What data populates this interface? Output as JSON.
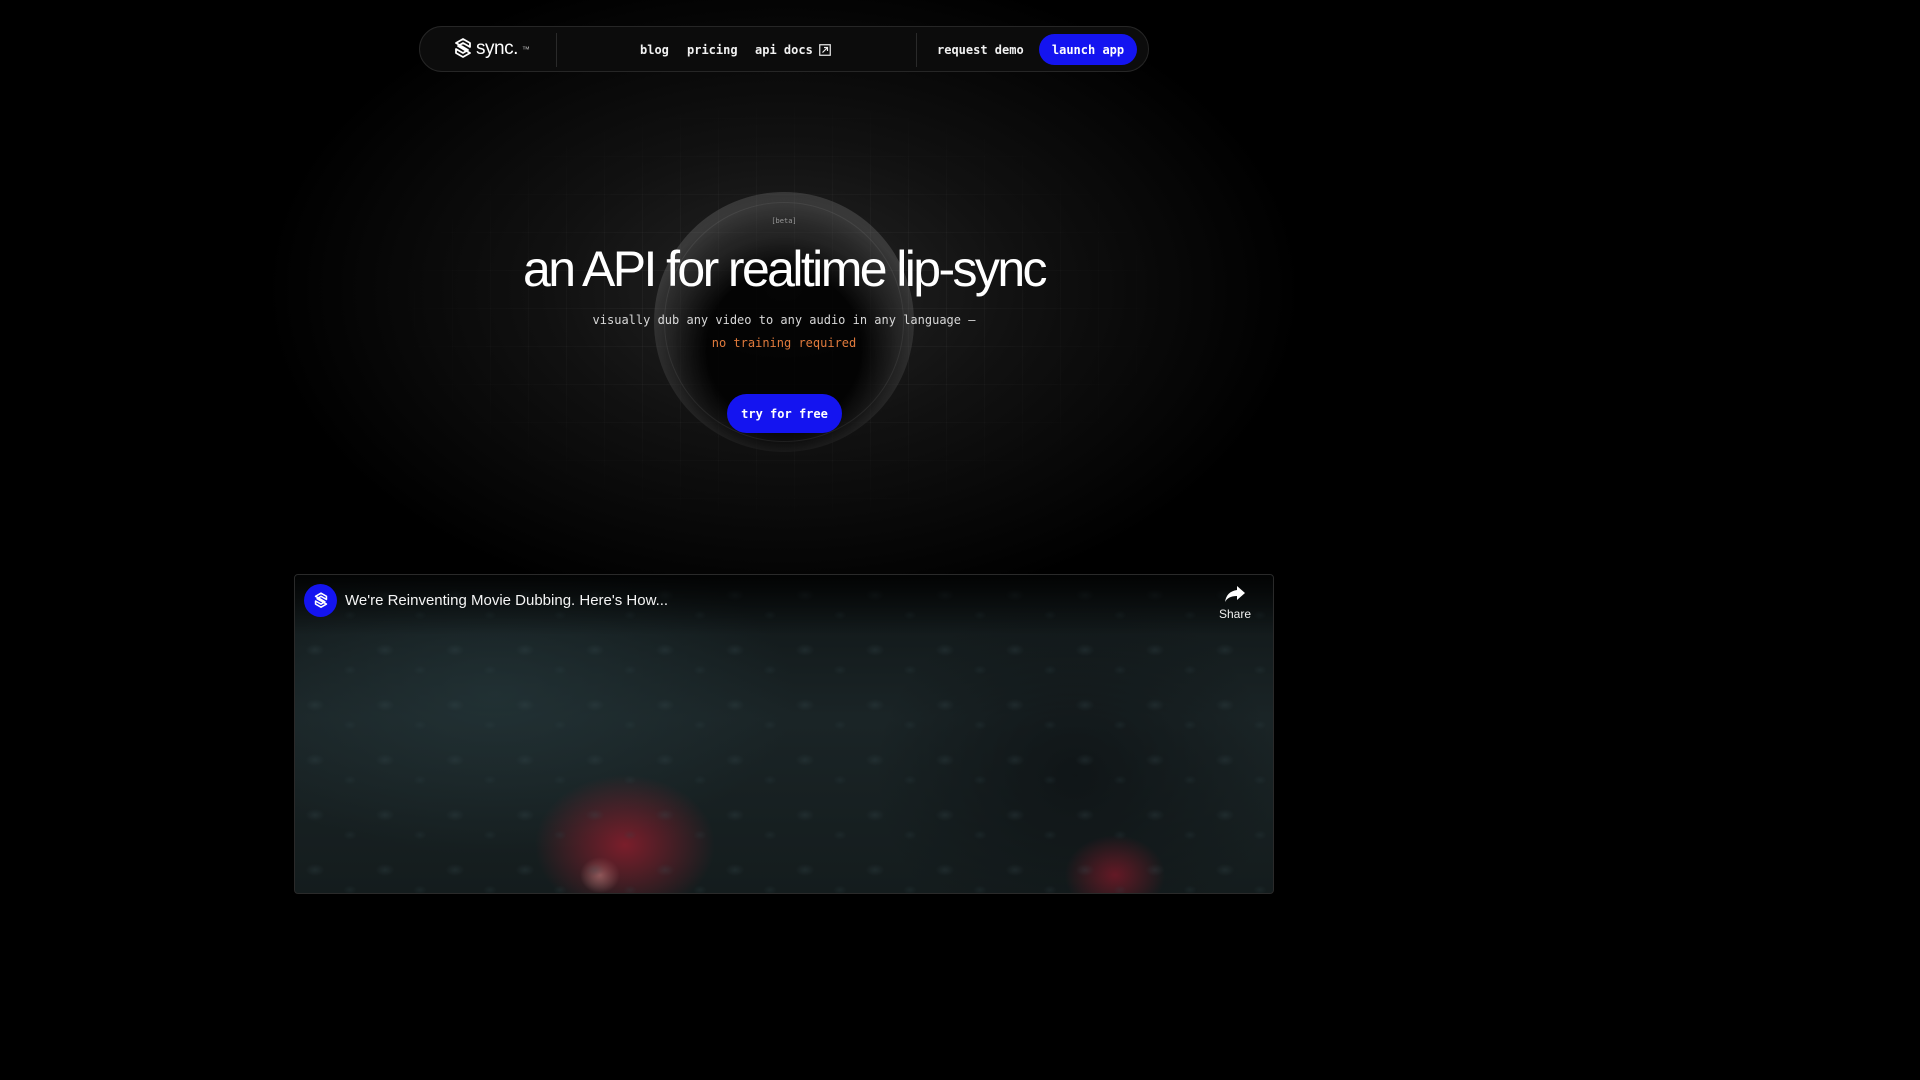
{
  "nav": {
    "brand": "sync.",
    "brand_suffix": "™",
    "links": [
      {
        "label": "blog"
      },
      {
        "label": "pricing"
      },
      {
        "label": "api docs"
      }
    ],
    "request_demo": "request demo",
    "launch_app": "launch app"
  },
  "hero": {
    "badge": "[beta]",
    "headline": "an API for realtime lip-sync",
    "subline": "visually dub any video to any audio in any language —",
    "subline_accent": "no training required",
    "cta": "try for free"
  },
  "video": {
    "title": "We're Reinventing Movie Dubbing. Here's How...",
    "share_label": "Share"
  },
  "colors": {
    "accent_blue": "#1414f0",
    "accent_orange": "#e07a3c",
    "background": "#000000"
  },
  "icons": {
    "brand": "sync-logo-icon",
    "external_link": "external-link-icon",
    "share": "share-arrow-icon"
  }
}
